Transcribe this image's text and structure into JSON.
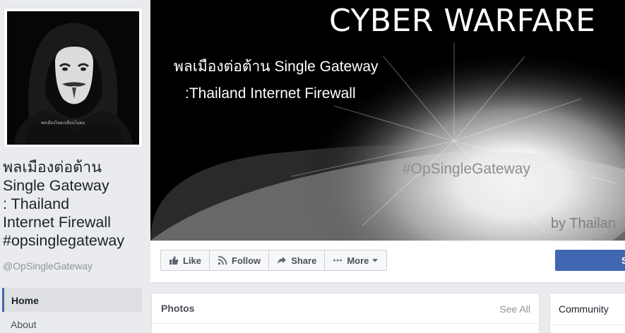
{
  "sidebar": {
    "page_name": "พลเมืองต่อต้าน\nSingle Gateway\n: Thailand\nInternet Firewall\n#opsinglegateway",
    "handle": "@OpSingleGateway",
    "nav": [
      {
        "label": "Home",
        "active": true
      },
      {
        "label": "About",
        "active": false
      }
    ],
    "profile_image": {
      "subject": "figure-in-hood-wearing-guy-fawkes-mask",
      "shirt_text": "พลเมืองไทยเปลี่ยนไม่ต่อ"
    }
  },
  "cover": {
    "title": "CYBER WARFARE",
    "line1": "พลเมืองต่อต้าน Single Gateway",
    "line2": ":Thailand Internet Firewall",
    "hashtag": "#OpSingleGateway",
    "watermark": "by Thailan"
  },
  "actions": {
    "like_label": "Like",
    "follow_label": "Follow",
    "share_label": "Share",
    "more_label": "More",
    "primary_label": "S"
  },
  "photos": {
    "title": "Photos",
    "see_all": "See All"
  },
  "community": {
    "title": "Community"
  },
  "colors": {
    "brand_blue": "#4267b2",
    "background": "#e9ebee"
  }
}
